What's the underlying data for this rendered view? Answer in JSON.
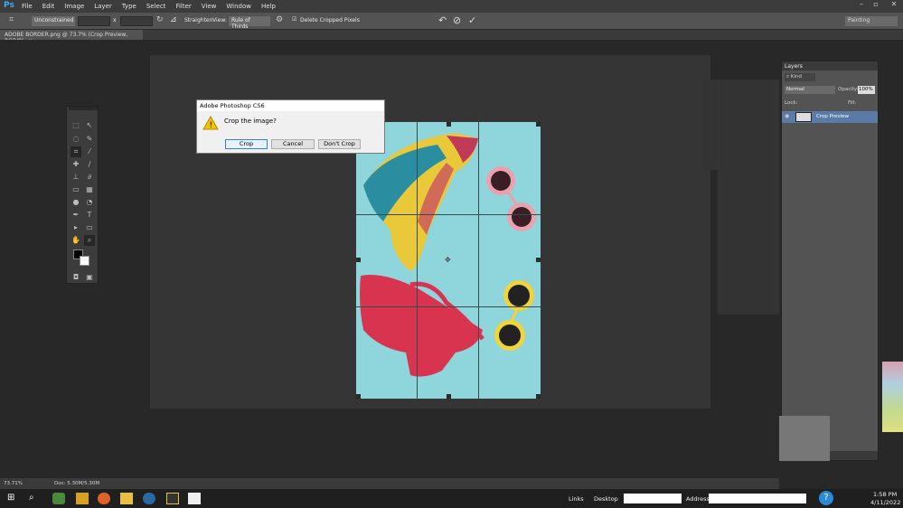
{
  "app": {
    "logo": "Ps"
  },
  "menu": [
    "File",
    "Edit",
    "Image",
    "Layer",
    "Type",
    "Select",
    "Filter",
    "View",
    "Window",
    "Help"
  ],
  "options": {
    "ratio": "Unconstrained",
    "straighten": "Straighten",
    "view_label": "View:",
    "view_value": "Rule of Thirds",
    "delete_cropped": "Delete Cropped Pixels",
    "workspace": "Painting"
  },
  "doc": {
    "tab": "ADOBE BORDER.png @ 73.7% (Crop Preview, RGB/8)"
  },
  "dialog": {
    "title": "Adobe Photoshop CS6",
    "message": "Crop the image?",
    "buttons": [
      "Crop",
      "Cancel",
      "Don't Crop"
    ]
  },
  "layers": {
    "title": "Layers",
    "kind": "Kind",
    "blend": "Normal",
    "opacity_label": "Opacity:",
    "opacity": "100%",
    "lock_label": "Lock:",
    "fill_label": "Fill:",
    "layer_name": "Crop Preview"
  },
  "status": {
    "zoom": "73.71%",
    "doc": "Doc: 5.30M/5.30M"
  },
  "taskbar": {
    "links": "Links",
    "desktop": "Desktop",
    "address": "Address",
    "time": "1:58 PM",
    "date": "4/11/2022"
  }
}
